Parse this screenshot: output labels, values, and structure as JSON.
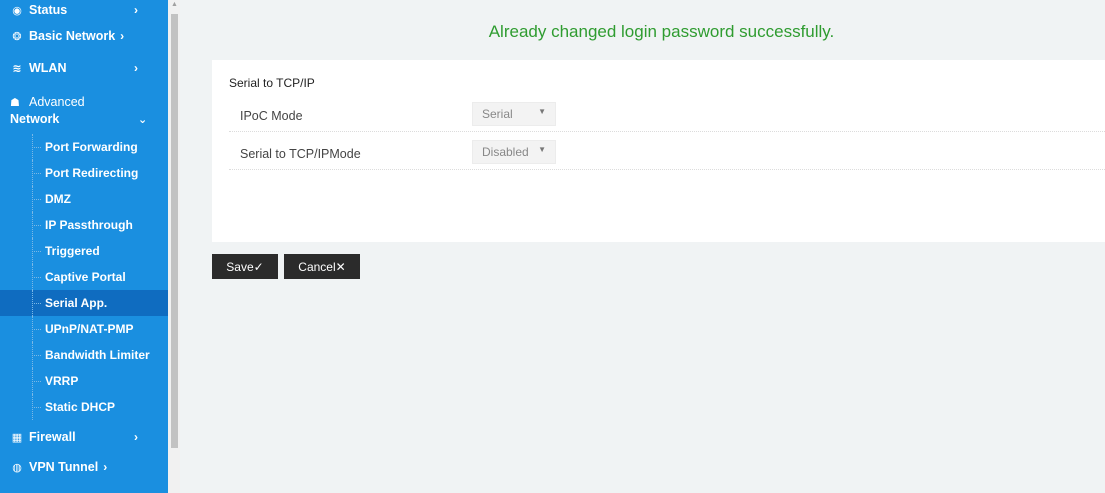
{
  "sidebar": {
    "items": [
      {
        "label": "Status",
        "icon": "eye-icon",
        "chevron": "›"
      },
      {
        "label": "Basic Network",
        "icon": "globe-icon",
        "chevron": "›"
      },
      {
        "label": "WLAN",
        "icon": "wifi-icon",
        "chevron": "›"
      }
    ],
    "advanced": {
      "label_line1": "Advanced",
      "label_line2": "Network",
      "icon": "router-icon",
      "chevron": "⌄"
    },
    "subitems": [
      {
        "label": "Port Forwarding",
        "active": false
      },
      {
        "label": "Port Redirecting",
        "active": false
      },
      {
        "label": "DMZ",
        "active": false
      },
      {
        "label": "IP Passthrough",
        "active": false
      },
      {
        "label": "Triggered",
        "active": false
      },
      {
        "label": "Captive Portal",
        "active": false
      },
      {
        "label": "Serial App.",
        "active": true
      },
      {
        "label": "UPnP/NAT-PMP",
        "active": false
      },
      {
        "label": "Bandwidth Limiter",
        "active": false
      },
      {
        "label": "VRRP",
        "active": false
      },
      {
        "label": "Static DHCP",
        "active": false
      }
    ],
    "bottom_items": [
      {
        "label": "Firewall",
        "icon": "firewall-icon",
        "chevron": "›"
      },
      {
        "label": "VPN Tunnel",
        "icon": "vpn-icon",
        "chevron": "›"
      }
    ]
  },
  "main": {
    "success_message": "Already changed login password successfully.",
    "panel_title": "Serial to TCP/IP",
    "fields": [
      {
        "label": "IPoC Mode",
        "value": "Serial"
      },
      {
        "label": "Serial to TCP/IPMode",
        "value": "Disabled"
      }
    ],
    "save_label": "Save✓",
    "cancel_label": "Cancel✕"
  },
  "colors": {
    "sidebar": "#1a8fe0",
    "active_item": "#0f6cc0",
    "success": "#2f9c30",
    "button": "#2b2b2b"
  }
}
